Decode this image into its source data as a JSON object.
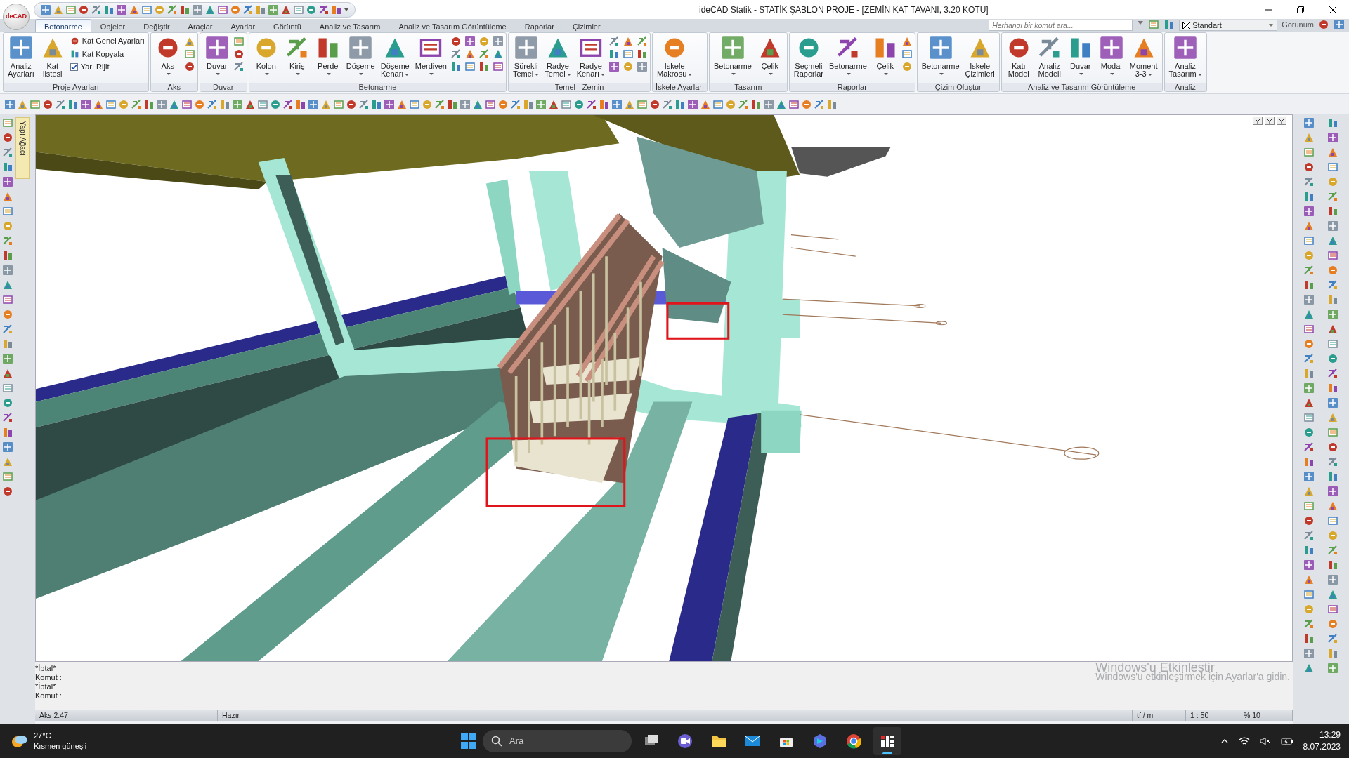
{
  "app": {
    "logo_text": "deCAD",
    "title": "ideCAD Statik - STATİK ŞABLON PROJE - [ZEMİN KAT TAVANI,  3.20 KOTU]"
  },
  "menu_tabs": [
    {
      "label": "Betonarme",
      "selected": true
    },
    {
      "label": "Objeler",
      "selected": false
    },
    {
      "label": "Değiştir",
      "selected": false
    },
    {
      "label": "Araçlar",
      "selected": false
    },
    {
      "label": "Ayarlar",
      "selected": false
    },
    {
      "label": "Görüntü",
      "selected": false
    },
    {
      "label": "Analiz ve Tasarım",
      "selected": false
    },
    {
      "label": "Analiz ve Tasarım Görüntüleme",
      "selected": false
    },
    {
      "label": "Raporlar",
      "selected": false
    },
    {
      "label": "Çizimler",
      "selected": false
    }
  ],
  "search": {
    "placeholder": "Herhangi bir komut ara..."
  },
  "layer_selector": {
    "value": "Standart"
  },
  "view_menu": {
    "label": "Görünüm"
  },
  "ribbon_groups": [
    {
      "label": "Proje Ayarları",
      "large_buttons": [
        {
          "label": "Analiz\nAyarları",
          "dropdown": false
        },
        {
          "label": "Kat\nlistesi",
          "dropdown": false
        }
      ],
      "small_buttons": [
        {
          "kind": "icon",
          "label": "Kat Genel Ayarları"
        },
        {
          "kind": "icon",
          "label": "Kat Kopyala"
        },
        {
          "kind": "checkbox",
          "label": "Yarı Rijit",
          "checked": true
        }
      ]
    },
    {
      "label": "Aks",
      "large_buttons": [
        {
          "label": "Aks",
          "dropdown": true
        }
      ]
    },
    {
      "label": "Duvar",
      "large_buttons": [
        {
          "label": "Duvar",
          "dropdown": true
        }
      ]
    },
    {
      "label": "Betonarme",
      "large_buttons": [
        {
          "label": "Kolon",
          "dropdown": true
        },
        {
          "label": "Kiriş",
          "dropdown": true
        },
        {
          "label": "Perde",
          "dropdown": true
        },
        {
          "label": "Döşeme",
          "dropdown": true
        },
        {
          "label": "Döşeme\nKenarı",
          "dropdown": true
        },
        {
          "label": "Merdiven",
          "dropdown": true
        }
      ]
    },
    {
      "label": "Temel - Zemin",
      "large_buttons": [
        {
          "label": "Sürekli\nTemel",
          "dropdown": true
        },
        {
          "label": "Radye\nTemel",
          "dropdown": true
        },
        {
          "label": "Radye\nKenarı",
          "dropdown": true
        }
      ]
    },
    {
      "label": "İskele Ayarları",
      "large_buttons": [
        {
          "label": "İskele\nMakrosu",
          "dropdown": true
        }
      ]
    },
    {
      "label": "Tasarım",
      "large_buttons": [
        {
          "label": "Betonarme",
          "dropdown": true
        },
        {
          "label": "Çelik",
          "dropdown": true
        }
      ]
    },
    {
      "label": "Raporlar",
      "large_buttons": [
        {
          "label": "Seçmeli\nRaporlar",
          "dropdown": false
        },
        {
          "label": "Betonarme",
          "dropdown": true
        },
        {
          "label": "Çelik",
          "dropdown": true
        }
      ]
    },
    {
      "label": "Çizim Oluştur",
      "large_buttons": [
        {
          "label": "Betonarme",
          "dropdown": true
        },
        {
          "label": "İskele\nÇizimleri",
          "dropdown": false
        }
      ]
    },
    {
      "label": "Analiz ve Tasarım Görüntüleme",
      "large_buttons": [
        {
          "label": "Katı\nModel",
          "dropdown": false
        },
        {
          "label": "Analiz\nModeli",
          "dropdown": false
        },
        {
          "label": "Duvar",
          "dropdown": true
        },
        {
          "label": "Modal",
          "dropdown": true
        },
        {
          "label": "Moment\n3-3",
          "dropdown": true
        }
      ]
    },
    {
      "label": "Analiz",
      "large_buttons": [
        {
          "label": "Analiz\nTasarım",
          "dropdown": true
        }
      ]
    }
  ],
  "side_tab": {
    "label": "Yapı Ağacı"
  },
  "command_lines": [
    "*İptal*",
    "Komut :",
    "*İptal*",
    "Komut :"
  ],
  "activation_notice": {
    "title": "Windows'u Etkinleştir",
    "text": "Windows'u etkinleştirmek için Ayarlar'a gidin."
  },
  "status_bar": {
    "left": [
      "Aks 2.47",
      "Hazır"
    ],
    "right": [
      "tf / m",
      "1 : 50",
      "% 10"
    ]
  },
  "taskbar": {
    "temperature": "27°C",
    "weather": "Kısmen güneşli",
    "search_placeholder": "Ara",
    "apps": [
      {
        "kind": "taskview",
        "selected": false
      },
      {
        "kind": "chat",
        "selected": false
      },
      {
        "kind": "folder",
        "selected": false
      },
      {
        "kind": "mail",
        "selected": false
      },
      {
        "kind": "store",
        "selected": false
      },
      {
        "kind": "swirl",
        "selected": false
      },
      {
        "kind": "browser",
        "selected": false
      },
      {
        "kind": "cad",
        "selected": true
      }
    ],
    "time": "13:29",
    "date": "8.07.2023"
  }
}
